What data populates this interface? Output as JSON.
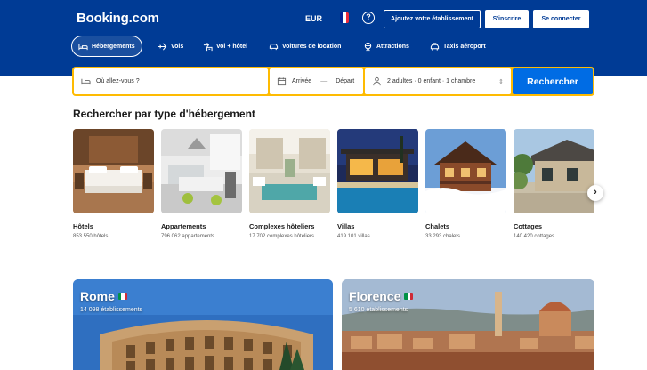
{
  "header": {
    "logo": "Booking.com",
    "currency": "EUR",
    "help_icon": "?",
    "list_property": "Ajoutez votre établissement",
    "register": "S'inscrire",
    "sign_in": "Se connecter"
  },
  "nav": [
    {
      "label": "Hébergements",
      "icon": "bed-icon",
      "active": true
    },
    {
      "label": "Vols",
      "icon": "plane-icon",
      "active": false
    },
    {
      "label": "Vol + hôtel",
      "icon": "plane-hotel-icon",
      "active": false
    },
    {
      "label": "Voitures de location",
      "icon": "car-icon",
      "active": false
    },
    {
      "label": "Attractions",
      "icon": "attraction-icon",
      "active": false
    },
    {
      "label": "Taxis aéroport",
      "icon": "taxi-icon",
      "active": false
    }
  ],
  "search": {
    "destination_placeholder": "Où allez-vous ?",
    "checkin": "Arrivée",
    "separator": "—",
    "checkout": "Départ",
    "guests": "2 adultes · 0 enfant · 1 chambre",
    "button": "Rechercher"
  },
  "property_types": {
    "title": "Rechercher par type d'hébergement",
    "items": [
      {
        "name": "Hôtels",
        "count": "853 550 hôtels"
      },
      {
        "name": "Appartements",
        "count": "796 062 appartements"
      },
      {
        "name": "Complexes hôteliers",
        "count": "17 702 complexes hôteliers"
      },
      {
        "name": "Villas",
        "count": "419 101 villas"
      },
      {
        "name": "Chalets",
        "count": "33 293 chalets"
      },
      {
        "name": "Cottages",
        "count": "140 420 cottages"
      }
    ],
    "next_icon": "›"
  },
  "destinations": [
    {
      "name": "Rome",
      "count": "14 098 établissements"
    },
    {
      "name": "Florence",
      "count": "5 610 établissements"
    }
  ],
  "colors": {
    "brand_blue": "#003b95",
    "search_yellow": "#febb02",
    "button_blue": "#006ce4"
  }
}
